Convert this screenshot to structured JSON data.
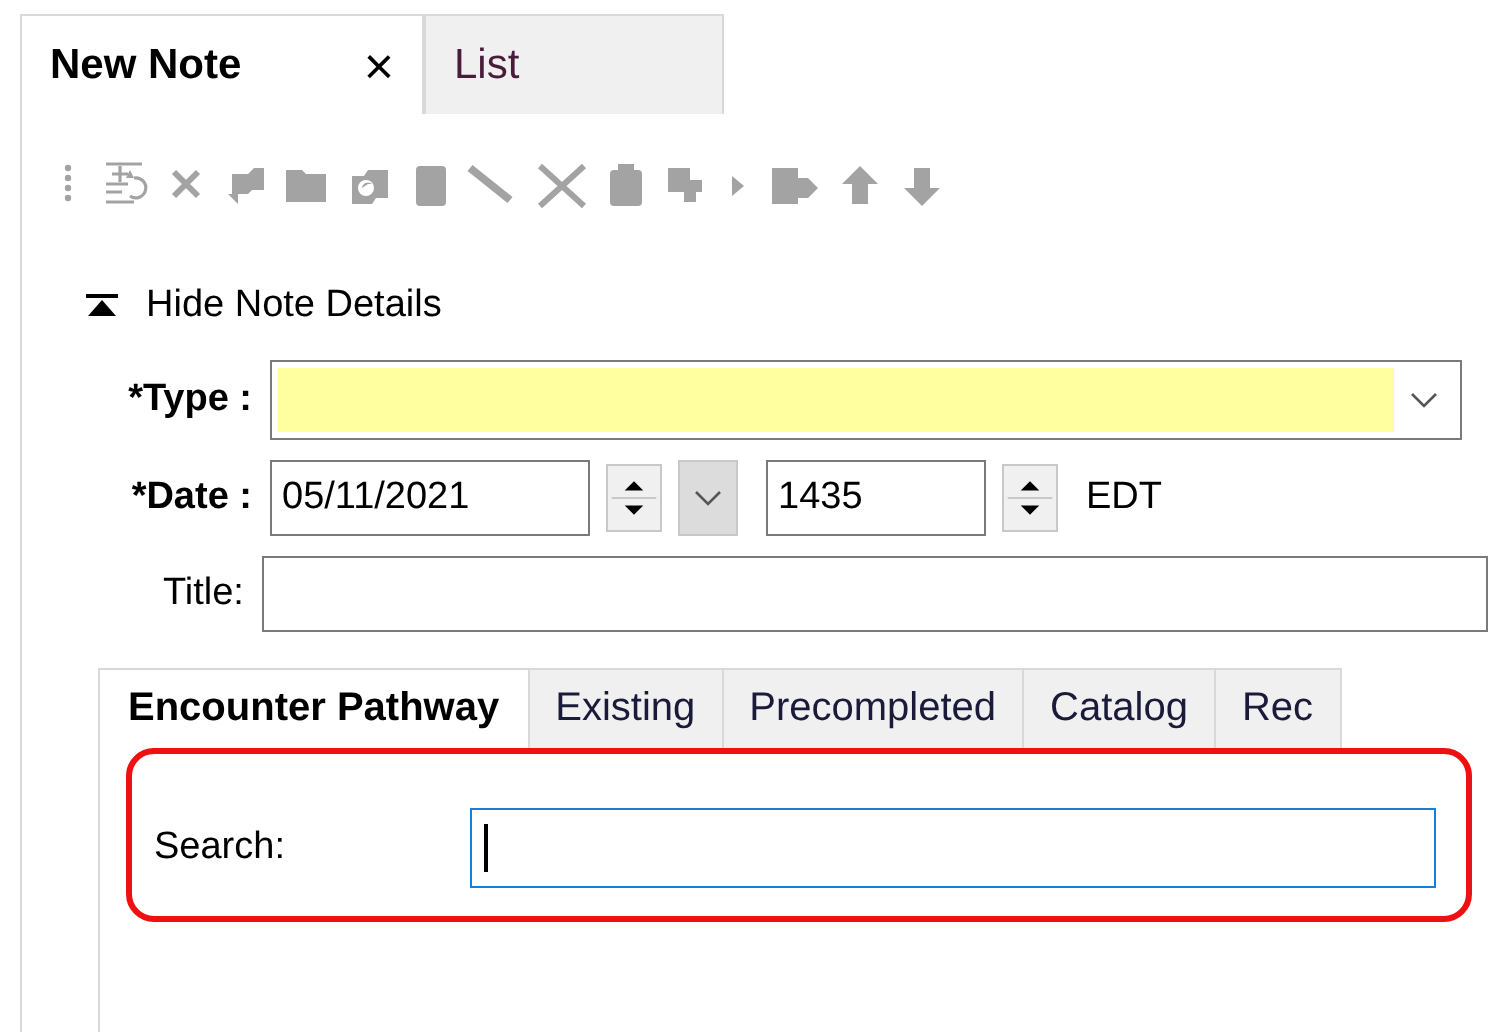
{
  "note_tabs": [
    {
      "label": "New Note",
      "selected": true,
      "close": "×"
    },
    {
      "label": "List",
      "selected": false
    }
  ],
  "details_toggle": {
    "label": "Hide Note Details",
    "expanded": true
  },
  "type_field": {
    "label": "*Type :",
    "required": true
  },
  "date_field": {
    "label": "*Date :",
    "required": true,
    "date": "05/11/2021",
    "time": "1435",
    "zone": "EDT"
  },
  "title_field": {
    "label": "Title:",
    "required": false
  },
  "pathway_tabs": [
    {
      "label": "Encounter Pathway",
      "selected": true
    },
    {
      "label": "Existing",
      "selected": false
    },
    {
      "label": "Precompleted",
      "selected": false
    },
    {
      "label": "Catalog",
      "selected": false
    },
    {
      "label": "Rec",
      "selected": false
    }
  ],
  "search": {
    "label": "Search:",
    "highlighted": true
  }
}
